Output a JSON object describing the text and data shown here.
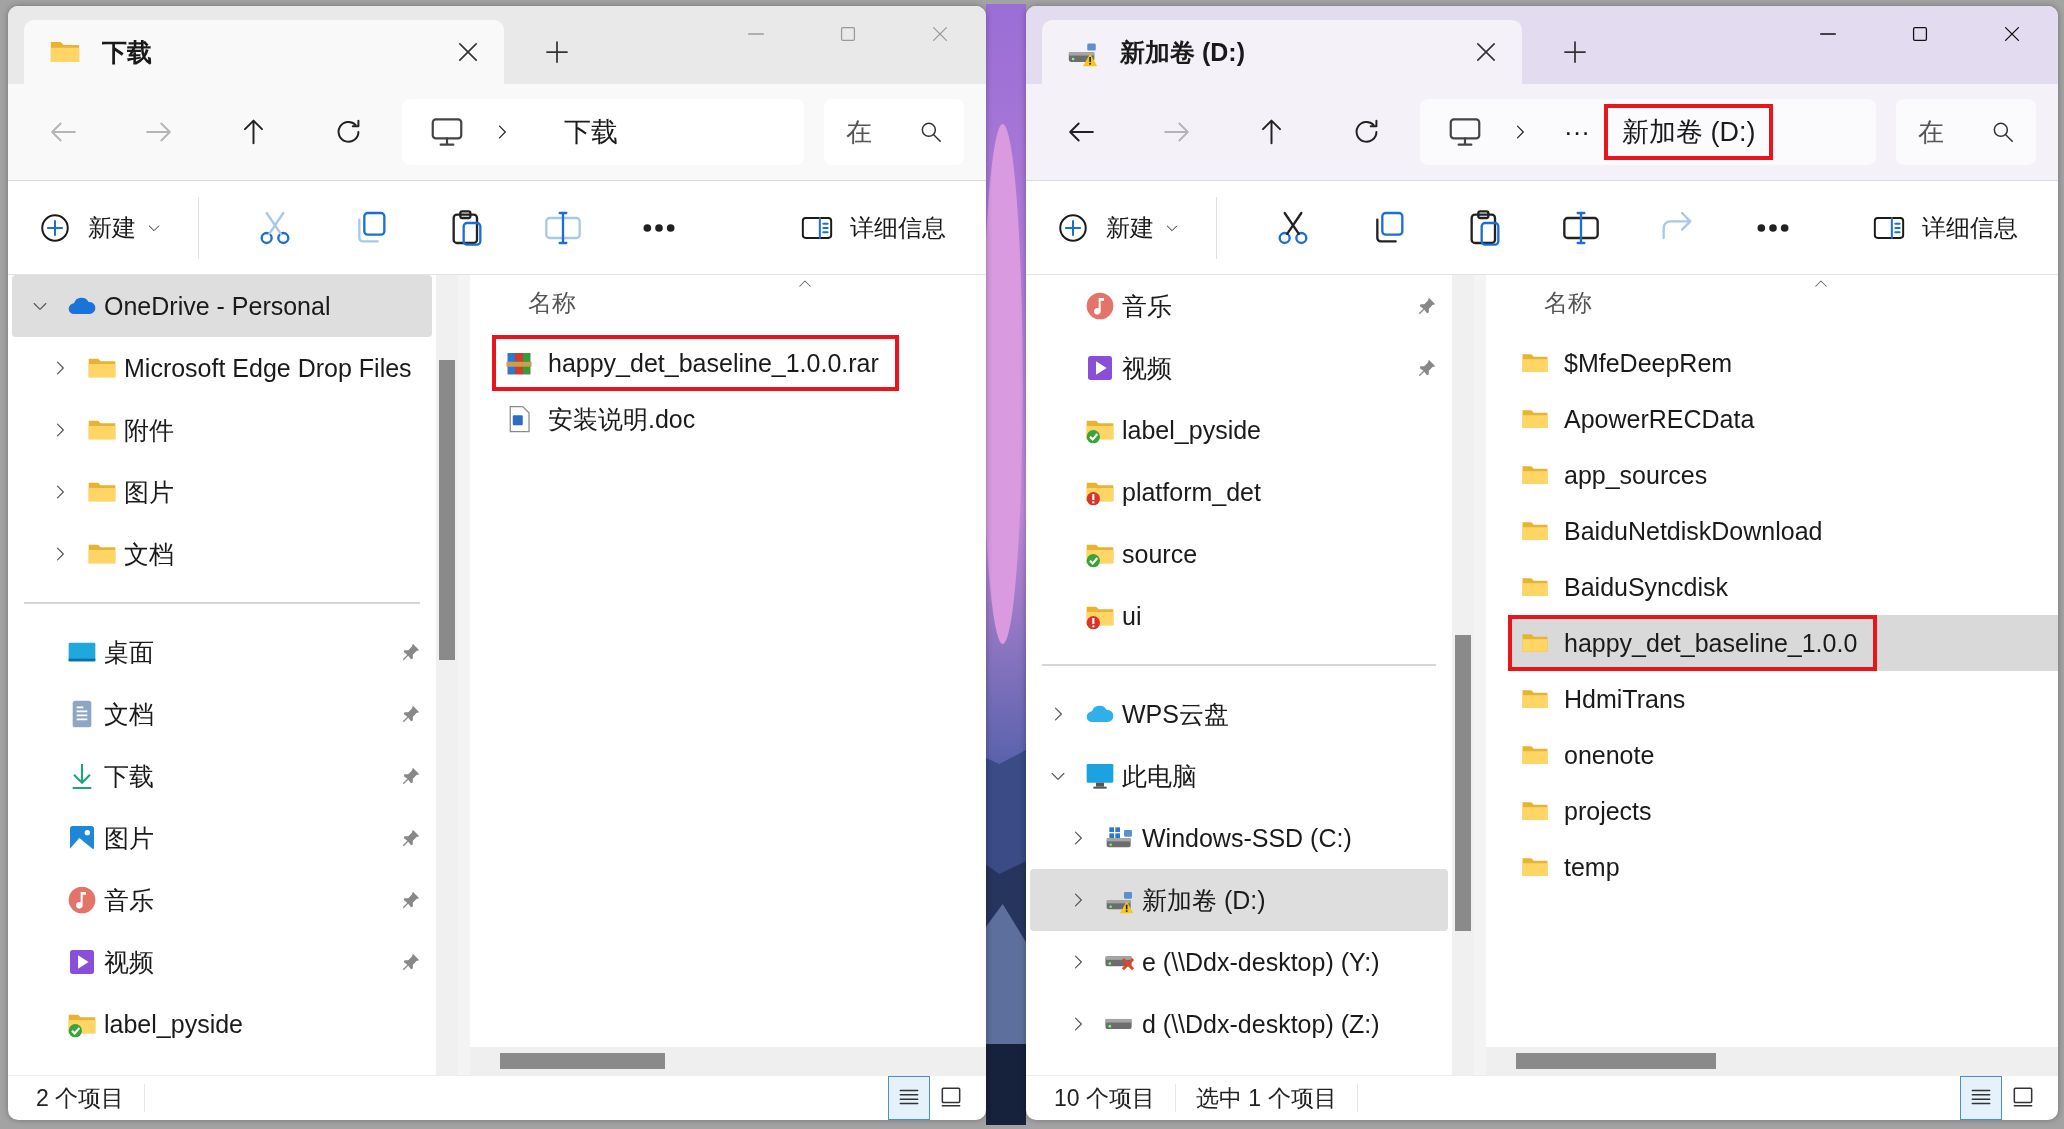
{
  "windows": [
    {
      "active": false,
      "tab": {
        "title": "下载",
        "kind": "folder"
      },
      "nav_buttons": [
        {
          "kind": "back",
          "disabled": true
        },
        {
          "kind": "forward",
          "disabled": true
        },
        {
          "kind": "up",
          "disabled": false
        },
        {
          "kind": "refresh",
          "disabled": false
        }
      ],
      "breadcrumb": [
        {
          "kind": "pc"
        },
        {
          "kind": "separator"
        },
        {
          "kind": "text",
          "label": "下载",
          "highlighted": false
        }
      ],
      "search": {
        "placeholder": "在"
      },
      "commands": [
        {
          "kind": "new",
          "label": "新建",
          "disabled": false
        },
        {
          "kind": "cut",
          "disabled": true
        },
        {
          "kind": "copy",
          "disabled": true
        },
        {
          "kind": "paste",
          "disabled": false
        },
        {
          "kind": "rename",
          "disabled": true
        },
        {
          "kind": "more",
          "disabled": false
        },
        {
          "kind": "details",
          "label": "详细信息",
          "disabled": false
        }
      ],
      "nav_groups": [
        {
          "items": [
            {
              "label": "OneDrive - Personal",
              "kind": "onedrive",
              "selected": true,
              "pinned": false,
              "expanded": true,
              "children": [
                {
                  "label": "Microsoft Edge Drop Files",
                  "kind": "folder",
                  "selected": false,
                  "pinned": false,
                  "expanded": false
                },
                {
                  "label": "附件",
                  "kind": "folder",
                  "selected": false,
                  "pinned": false,
                  "expanded": false
                },
                {
                  "label": "图片",
                  "kind": "folder",
                  "selected": false,
                  "pinned": false,
                  "expanded": false
                },
                {
                  "label": "文档",
                  "kind": "folder",
                  "selected": false,
                  "pinned": false,
                  "expanded": false
                }
              ]
            }
          ]
        },
        {
          "items": [
            {
              "label": "桌面",
              "kind": "desktop",
              "selected": false,
              "pinned": true
            },
            {
              "label": "文档",
              "kind": "documents",
              "selected": false,
              "pinned": true
            },
            {
              "label": "下载",
              "kind": "downloads",
              "selected": false,
              "pinned": true
            },
            {
              "label": "图片",
              "kind": "pictures",
              "selected": false,
              "pinned": true
            },
            {
              "label": "音乐",
              "kind": "music",
              "selected": false,
              "pinned": true
            },
            {
              "label": "视频",
              "kind": "videos",
              "selected": false,
              "pinned": true
            },
            {
              "label": "label_pyside",
              "kind": "folder-ok",
              "selected": false,
              "pinned": false
            }
          ]
        }
      ],
      "column_header": "名称",
      "files": [
        {
          "name": "happy_det_baseline_1.0.0.rar",
          "kind": "rar",
          "selected": false,
          "highlighted": true
        },
        {
          "name": "安装说明.doc",
          "kind": "doc",
          "selected": false,
          "highlighted": false
        }
      ],
      "status": [
        "2 个项目"
      ],
      "views": [
        {
          "kind": "details",
          "selected": true
        },
        {
          "kind": "tiles",
          "selected": false
        }
      ]
    },
    {
      "active": true,
      "tab": {
        "title": "新加卷 (D:)",
        "kind": "drive-warning"
      },
      "nav_buttons": [
        {
          "kind": "back",
          "disabled": false
        },
        {
          "kind": "forward",
          "disabled": true
        },
        {
          "kind": "up",
          "disabled": false
        },
        {
          "kind": "refresh",
          "disabled": false
        }
      ],
      "breadcrumb": [
        {
          "kind": "pc"
        },
        {
          "kind": "separator"
        },
        {
          "kind": "overflow",
          "label": "···"
        },
        {
          "kind": "text",
          "label": "新加卷 (D:)",
          "highlighted": true
        }
      ],
      "search": {
        "placeholder": "在"
      },
      "commands": [
        {
          "kind": "new",
          "label": "新建",
          "disabled": false
        },
        {
          "kind": "cut",
          "disabled": false
        },
        {
          "kind": "copy",
          "disabled": false
        },
        {
          "kind": "paste",
          "disabled": false
        },
        {
          "kind": "rename",
          "disabled": false
        },
        {
          "kind": "share",
          "disabled": true
        },
        {
          "kind": "more",
          "disabled": false
        },
        {
          "kind": "details",
          "label": "详细信息",
          "disabled": false
        }
      ],
      "nav_groups": [
        {
          "items": [
            {
              "label": "音乐",
              "kind": "music",
              "selected": false,
              "pinned": true
            },
            {
              "label": "视频",
              "kind": "videos",
              "selected": false,
              "pinned": true
            },
            {
              "label": "label_pyside",
              "kind": "folder-ok",
              "selected": false,
              "pinned": false
            },
            {
              "label": "platform_det",
              "kind": "folder-error",
              "selected": false,
              "pinned": false
            },
            {
              "label": "source",
              "kind": "folder-ok",
              "selected": false,
              "pinned": false
            },
            {
              "label": "ui",
              "kind": "folder-error",
              "selected": false,
              "pinned": false
            }
          ]
        },
        {
          "items": [
            {
              "label": "WPS云盘",
              "kind": "wps-cloud",
              "selected": false,
              "pinned": false,
              "expanded": false
            },
            {
              "label": "此电脑",
              "kind": "pc",
              "selected": false,
              "pinned": false,
              "expanded": true,
              "children": [
                {
                  "label": "Windows-SSD (C:)",
                  "kind": "drive-windows",
                  "selected": false,
                  "pinned": false,
                  "expanded": false
                },
                {
                  "label": "新加卷 (D:)",
                  "kind": "drive-warning",
                  "selected": true,
                  "pinned": false,
                  "expanded": false
                },
                {
                  "label": "e (\\\\Ddx-desktop) (Y:)",
                  "kind": "drive-network-error",
                  "selected": false,
                  "pinned": false,
                  "expanded": false
                },
                {
                  "label": "d (\\\\Ddx-desktop) (Z:)",
                  "kind": "drive-network",
                  "selected": false,
                  "pinned": false,
                  "expanded": false
                }
              ]
            }
          ]
        }
      ],
      "column_header": "名称",
      "files": [
        {
          "name": "$MfeDeepRem",
          "kind": "folder",
          "selected": false,
          "highlighted": false
        },
        {
          "name": "ApowerRECData",
          "kind": "folder",
          "selected": false,
          "highlighted": false
        },
        {
          "name": "app_sources",
          "kind": "folder",
          "selected": false,
          "highlighted": false
        },
        {
          "name": "BaiduNetdiskDownload",
          "kind": "folder",
          "selected": false,
          "highlighted": false
        },
        {
          "name": "BaiduSyncdisk",
          "kind": "folder",
          "selected": false,
          "highlighted": false
        },
        {
          "name": "happy_det_baseline_1.0.0",
          "kind": "folder",
          "selected": true,
          "highlighted": true
        },
        {
          "name": "HdmiTrans",
          "kind": "folder",
          "selected": false,
          "highlighted": false
        },
        {
          "name": "onenote",
          "kind": "folder",
          "selected": false,
          "highlighted": false
        },
        {
          "name": "projects",
          "kind": "folder",
          "selected": false,
          "highlighted": false
        },
        {
          "name": "temp",
          "kind": "folder",
          "selected": false,
          "highlighted": false
        }
      ],
      "status": [
        "10 个项目",
        "选中 1 个项目"
      ],
      "views": [
        {
          "kind": "details",
          "selected": true
        },
        {
          "kind": "tiles",
          "selected": false
        }
      ]
    }
  ]
}
